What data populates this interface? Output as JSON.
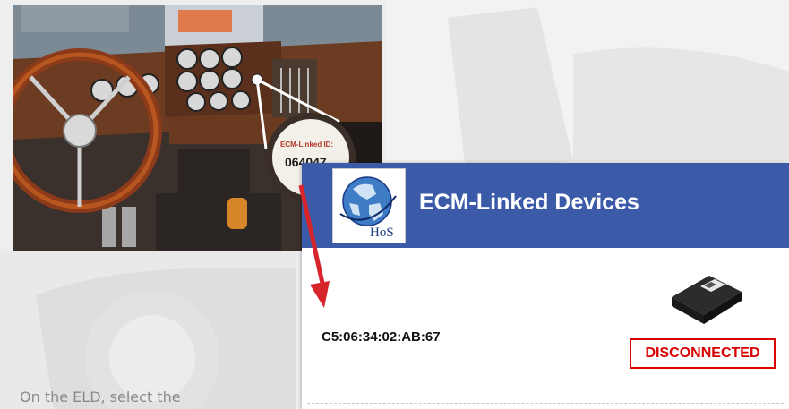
{
  "photo": {
    "ecm_label_title": "ECM-Linked ID:",
    "ecm_label_value": "064047"
  },
  "app": {
    "logo_text": "HoS",
    "title": "ECM-Linked Devices",
    "device": {
      "mac_address": "C5:06:34:02:AB:67",
      "status": "DISCONNECTED"
    }
  },
  "instruction": "On the ELD, select the",
  "colors": {
    "header": "#3b5ba9",
    "status_red": "#d90000",
    "arrow_red": "#d8242b"
  }
}
